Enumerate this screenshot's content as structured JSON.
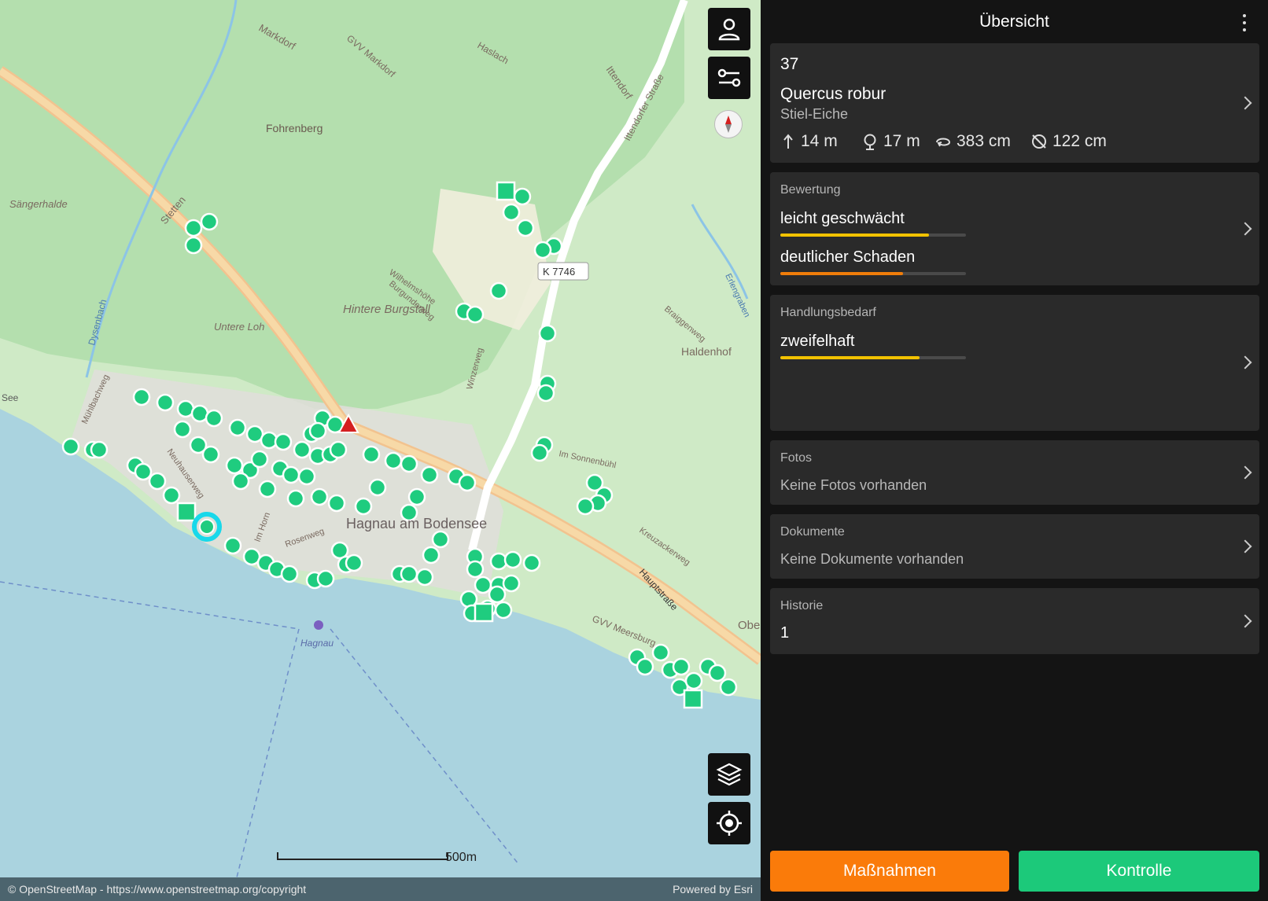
{
  "map": {
    "labels": {
      "markdorf": "Markdorf",
      "gvv_markdorf": "GVV Markdorf",
      "haslach": "Haslach",
      "ittendorf": "Ittendorf",
      "ittendorfer_strasse": "Ittendorfer Straße",
      "fohrenberg": "Fohrenberg",
      "saengerhalde": "Sängerhalde",
      "stetten": "Stetten",
      "dysenbach": "Dysenbach",
      "untere_loh": "Untere Loh",
      "hintere_burgstall": "Hintere Burgstall",
      "wilhelmshoehe": "Wilhelmshöhe",
      "burgunderweg": "Burgunderweg",
      "winzerweg": "Winzerweg",
      "k7746": "K 7746",
      "braiggenweg": "Braiggenweg",
      "erlengraben": "Erlengraben",
      "haldenhof": "Haldenhof",
      "muehlbachweg": "Mühlbachweg",
      "neuhauserweg": "Neuhauserweg",
      "im_horn": "Im Horn",
      "rosenweg": "Rosenweg",
      "town": "Hagnau am Bodensee",
      "sonnenbuehl": "Im Sonnenbühl",
      "kreuzackerweg": "Kreuzackerweg",
      "hauptstrasse": "Hauptstraße",
      "gvv_meersburg": "GVV Meersburg",
      "hagnau_harbor": "Hagnau",
      "see": "See",
      "obe": "Obe"
    },
    "scale_label": "500m",
    "attribution_left": "© OpenStreetMap - https://www.openstreetmap.org/copyright",
    "attribution_right": "Powered by Esri",
    "marker_color": "#1fcc7f",
    "selected_color": "#18d8ea",
    "warning_color": "#d42020"
  },
  "panel": {
    "title": "Übersicht",
    "tree": {
      "number": "37",
      "species_latin": "Quercus robur",
      "species_german": "Stiel-Eiche",
      "height": "14 m",
      "crown": "17 m",
      "circumference": "383 cm",
      "diameter": "122 cm"
    },
    "bewertung": {
      "label": "Bewertung",
      "items": [
        {
          "text": "leicht geschwächt",
          "level": 0.8,
          "color": "#f2c200"
        },
        {
          "text": "deutlicher Schaden",
          "level": 0.66,
          "color": "#f07d0a"
        }
      ]
    },
    "handlungsbedarf": {
      "label": "Handlungsbedarf",
      "text": "zweifelhaft",
      "level": 0.75,
      "color": "#f2c200"
    },
    "fotos": {
      "label": "Fotos",
      "text": "Keine Fotos vorhanden"
    },
    "dokumente": {
      "label": "Dokumente",
      "text": "Keine Dokumente vorhanden"
    },
    "historie": {
      "label": "Historie",
      "text": "1"
    },
    "buttons": {
      "massnahmen": "Maßnahmen",
      "kontrolle": "Kontrolle",
      "massnahmen_color": "#fa7b0a",
      "kontrolle_color": "#1cc97a"
    }
  }
}
